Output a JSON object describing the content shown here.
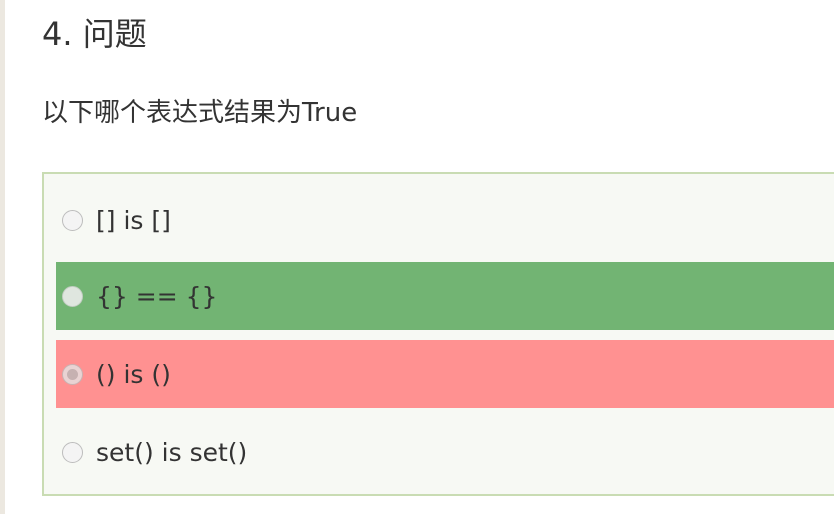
{
  "question": {
    "title": "4. 问题",
    "text": "以下哪个表达式结果为True"
  },
  "options": [
    {
      "label": "[] is []",
      "state": "unselected"
    },
    {
      "label": "{} == {}",
      "state": "correct"
    },
    {
      "label": "() is ()",
      "state": "incorrect-selected"
    },
    {
      "label": "set() is set()",
      "state": "unselected"
    }
  ],
  "colors": {
    "correct": "#72b473",
    "incorrect": "#ff9191",
    "box_border": "#c9dcb3",
    "box_background": "#f7f9f4"
  }
}
